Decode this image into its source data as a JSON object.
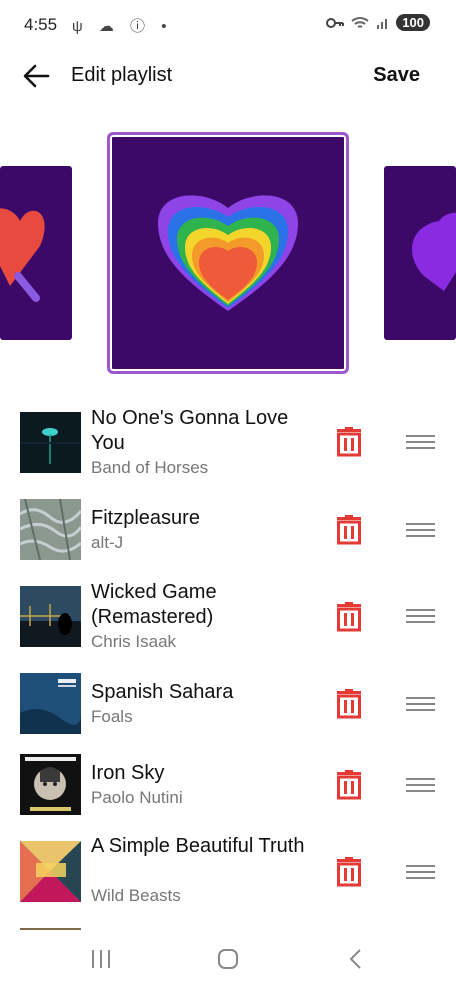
{
  "status": {
    "time": "4:55",
    "battery": "100"
  },
  "header": {
    "title": "Edit playlist",
    "save_label": "Save"
  },
  "tracks": [
    {
      "title": "No One's Gonna Love You",
      "artist": "Band of Horses"
    },
    {
      "title": "Fitzpleasure",
      "artist": "alt-J"
    },
    {
      "title": "Wicked Game (Remastered)",
      "artist": "Chris Isaak"
    },
    {
      "title": "Spanish Sahara",
      "artist": "Foals"
    },
    {
      "title": "Iron Sky",
      "artist": "Paolo Nutini"
    },
    {
      "title": "A Simple Beautiful Truth",
      "artist": "Wild Beasts"
    }
  ],
  "colors": {
    "accent": "#9b59d0",
    "cover_bg": "#3c0968",
    "delete": "#e53935"
  }
}
